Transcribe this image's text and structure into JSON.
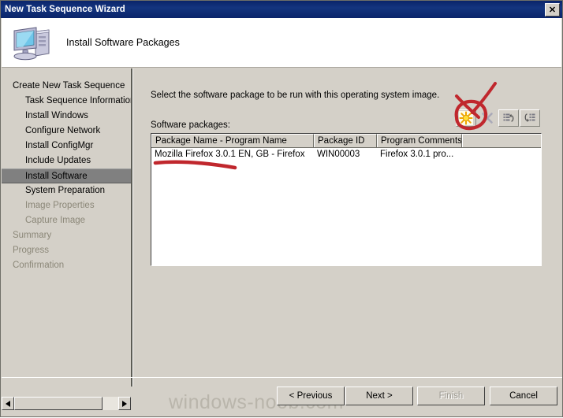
{
  "window": {
    "title": "New Task Sequence Wizard",
    "close_label": "✕"
  },
  "header": {
    "title": "Install Software Packages",
    "icon": "computer-icon"
  },
  "sidebar": {
    "items": [
      {
        "label": "Create New Task Sequence",
        "indent": false,
        "state": "normal"
      },
      {
        "label": "Task Sequence Information",
        "indent": true,
        "state": "normal"
      },
      {
        "label": "Install Windows",
        "indent": true,
        "state": "normal"
      },
      {
        "label": "Configure Network",
        "indent": true,
        "state": "normal"
      },
      {
        "label": "Install ConfigMgr",
        "indent": true,
        "state": "normal"
      },
      {
        "label": "Include Updates",
        "indent": true,
        "state": "normal"
      },
      {
        "label": "Install Software",
        "indent": true,
        "state": "selected"
      },
      {
        "label": "System Preparation",
        "indent": true,
        "state": "normal"
      },
      {
        "label": "Image Properties",
        "indent": true,
        "state": "disabled"
      },
      {
        "label": "Capture Image",
        "indent": true,
        "state": "disabled"
      },
      {
        "label": "Summary",
        "indent": false,
        "state": "disabled"
      },
      {
        "label": "Progress",
        "indent": false,
        "state": "disabled"
      },
      {
        "label": "Confirmation",
        "indent": false,
        "state": "disabled"
      }
    ],
    "scrollbar": {
      "left_arrow": "◀",
      "right_arrow": "▶"
    }
  },
  "main": {
    "instruction": "Select the software package to be run with this operating system image.",
    "packages_label": "Software packages:",
    "toolbar": [
      {
        "name": "new-package-button",
        "icon": "yellow-star-icon",
        "enabled": true
      },
      {
        "name": "delete-package-button",
        "icon": "x-delete-icon",
        "enabled": false
      },
      {
        "name": "move-up-button",
        "icon": "list-up-icon",
        "enabled": false
      },
      {
        "name": "move-down-button",
        "icon": "list-down-icon",
        "enabled": false
      }
    ],
    "table": {
      "columns": [
        "Package Name - Program Name",
        "Package ID",
        "Program Comments",
        ""
      ],
      "rows": [
        [
          "Mozilla Firefox 3.0.1 EN, GB - Firefox",
          "WIN00003",
          "Firefox 3.0.1 pro...",
          ""
        ]
      ]
    }
  },
  "buttons": {
    "previous": "< Previous",
    "next": "Next >",
    "finish": "Finish",
    "cancel": "Cancel"
  },
  "watermark": "windows-noob.com",
  "colors": {
    "titlebar": "#0a246a",
    "dialog_face": "#d4d0c8",
    "selection": "#808080",
    "annotation_red": "#c0272d",
    "star_yellow": "#ffd700"
  }
}
